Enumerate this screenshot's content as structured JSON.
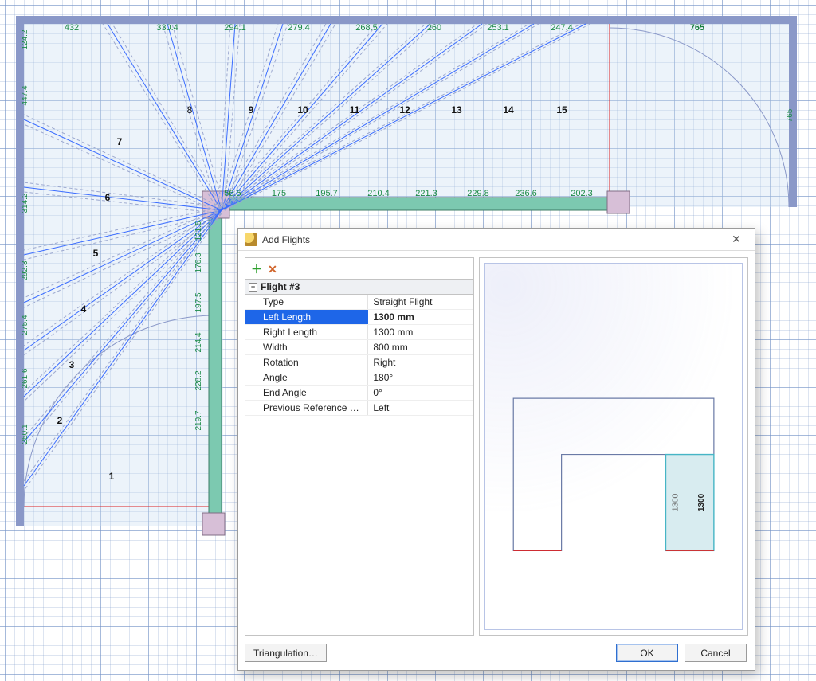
{
  "plan": {
    "top_measurements": [
      "432",
      "330.4",
      "294.1",
      "279.4",
      "268.5",
      "260",
      "253.1",
      "247.4",
      "765"
    ],
    "left_measurements": [
      "124.2",
      "447.4",
      "314.2",
      "292.3",
      "275.4",
      "261.6",
      "250.1"
    ],
    "right_measurement": "765",
    "rail_measurements_left": [
      "121.5",
      "176.3",
      "197.5",
      "214.4",
      "228.2",
      "219.7"
    ],
    "rail_measurements_top": [
      "56.5",
      "175",
      "195.7",
      "210.4",
      "221.3",
      "229.8",
      "236.6",
      "202.3"
    ],
    "step_numbers_top": [
      "8",
      "9",
      "10",
      "11",
      "12",
      "13",
      "14",
      "15"
    ],
    "step_numbers_left": [
      "7",
      "6",
      "5",
      "4",
      "3",
      "2",
      "1"
    ]
  },
  "dialog": {
    "title": "Add Flights",
    "flight_header": "Flight #3",
    "props": [
      {
        "k": "Type",
        "v": "Straight Flight",
        "sel": false
      },
      {
        "k": "Left Length",
        "v": "1300 mm",
        "sel": true
      },
      {
        "k": "Right Length",
        "v": "1300 mm",
        "sel": false
      },
      {
        "k": "Width",
        "v": "800 mm",
        "sel": false
      },
      {
        "k": "Rotation",
        "v": "Right",
        "sel": false
      },
      {
        "k": "Angle",
        "v": "180°",
        "sel": false
      },
      {
        "k": "End Angle",
        "v": "0°",
        "sel": false
      },
      {
        "k": "Previous Reference Side",
        "v": "Left",
        "sel": false
      }
    ],
    "preview": {
      "left_len": "1300",
      "right_len": "1300"
    },
    "buttons": {
      "triangulation": "Triangulation…",
      "ok": "OK",
      "cancel": "Cancel"
    }
  }
}
